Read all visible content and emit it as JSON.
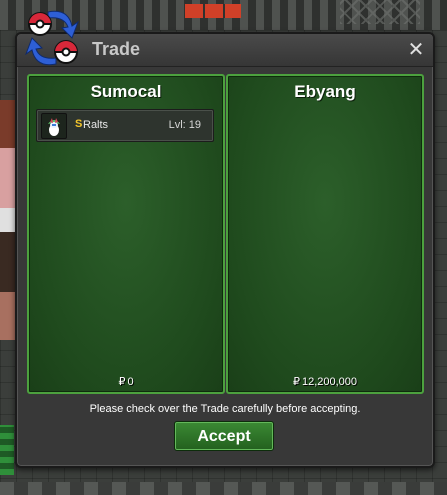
{
  "window": {
    "title": "Trade",
    "close_glyph": "✕"
  },
  "trade": {
    "left": {
      "name": "Sumocal",
      "money_symbol": "₽",
      "money": "0",
      "items": [
        {
          "icon": "ralts-sprite-icon",
          "badge": "S",
          "name": "Ralts",
          "level": "Lvl: 19"
        }
      ]
    },
    "right": {
      "name": "Ebyang",
      "money_symbol": "₽",
      "money": "12,200,000",
      "items": []
    }
  },
  "notice": "Please check over the Trade carefully before accepting.",
  "buttons": {
    "accept": "Accept"
  },
  "colors": {
    "panel_green": "#1f4a1d",
    "panel_border": "#4ca13e",
    "accept_green": "#2f7a29",
    "badge_gold": "#f2c52b"
  }
}
